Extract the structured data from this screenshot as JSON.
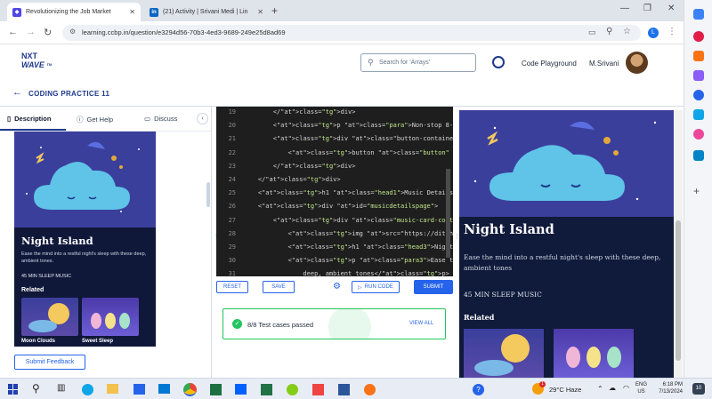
{
  "browser": {
    "tabs": [
      {
        "title": "Revolutionizing the Job Market"
      },
      {
        "title": "(21) Activity | Srivani Medi | Lin"
      }
    ],
    "url": "learning.ccbp.in/question/e3294d56-70b3-4ed3-9689-249e25d8ad69",
    "profile_initial": "L"
  },
  "app": {
    "logo_line1": "NXT",
    "logo_line2": "WAVE",
    "logo_tm": "TM",
    "search_placeholder": "Search for 'Arrays'",
    "code_playground": "Code Playground",
    "user_name": "M.Srivani",
    "back_title": "CODING PRACTICE 11"
  },
  "left_panel": {
    "tabs": [
      "Description",
      "Get Help",
      "Discuss"
    ],
    "card": {
      "title": "Night Island",
      "description": "Ease the mind into a restful night's sleep with these deep, ambient tones.",
      "duration": "45 MIN SLEEP MUSIC",
      "related_heading": "Related",
      "related": [
        "Moon Clouds",
        "Sweet Sleep"
      ]
    },
    "feedback_button": "Submit Feedback"
  },
  "editor": {
    "lines": [
      {
        "n": "19",
        "html": "        </div>"
      },
      {
        "n": "20",
        "html": "        <p class=\"para\">Non-stop 8-hours mixe"
      },
      {
        "n": "21",
        "html": "        <div class=\"button-container d-flex f"
      },
      {
        "n": "22",
        "html": "            <button class=\"button\" Onclick=\"d"
      },
      {
        "n": "23",
        "html": "        </div>"
      },
      {
        "n": "24",
        "html": "    </div>"
      },
      {
        "n": "25",
        "html": "    <h1 class=\"head1\">Music Details Page</h1"
      },
      {
        "n": "26",
        "html": "    <div id=\"musicdetailspage\">"
      },
      {
        "n": "27",
        "html": "        <div class=\"music-card-container\">"
      },
      {
        "n": "28",
        "html": "            <img src=\"https://ditgh0fmlzexmh."
      },
      {
        "n": "29",
        "html": "            <h1 class=\"head3\">Night Island</h"
      },
      {
        "n": "30",
        "html": "            <p class=\"para3\">Ease the mind in"
      },
      {
        "n": "31",
        "html": "                deep, ambient tones</p>"
      }
    ],
    "buttons": {
      "reset": "RESET",
      "save": "SAVE",
      "run": "RUN CODE",
      "submit": "SUBMIT"
    },
    "test_result": "8/8 Test cases passed",
    "view_all": "VIEW ALL"
  },
  "preview": {
    "title": "Night Island",
    "description": "Ease the mind into a restful night's sleep with these deep, ambient tones",
    "duration": "45 MIN SLEEP MUSIC",
    "related_heading": "Related"
  },
  "taskbar": {
    "weather": "29°C Haze",
    "weather_badge": "1",
    "lang_line1": "ENG",
    "lang_line2": "US",
    "time": "6:18 PM",
    "date": "7/13/2024",
    "notif_count": "10"
  },
  "colors": {
    "accent": "#2563eb",
    "editor_bg": "#1e1e1e",
    "preview_bg": "#101a3a",
    "success": "#22c55e"
  }
}
